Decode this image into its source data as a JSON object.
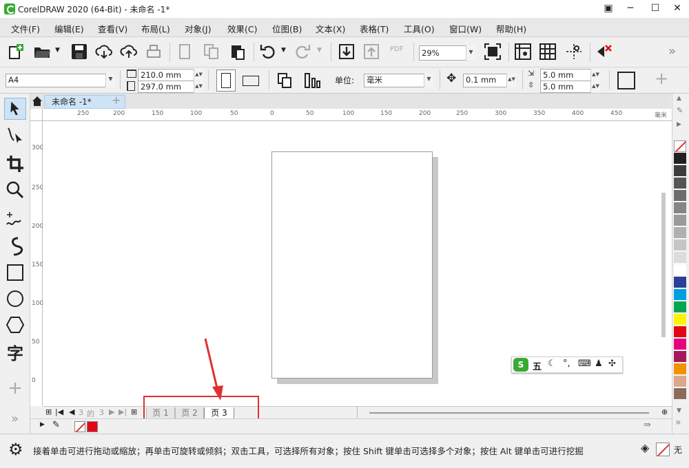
{
  "window": {
    "title": "CorelDRAW 2020 (64-Bit) - 未命名 -1*"
  },
  "menu": [
    "文件(F)",
    "编辑(E)",
    "查看(V)",
    "布局(L)",
    "对象(J)",
    "效果(C)",
    "位图(B)",
    "文本(X)",
    "表格(T)",
    "工具(O)",
    "窗口(W)",
    "帮助(H)"
  ],
  "toolbar": {
    "zoom": "29%",
    "pdf_label": "PDF"
  },
  "propbar": {
    "page_size": "A4",
    "width": "210.0 mm",
    "height": "297.0 mm",
    "unit_label": "单位:",
    "unit": "毫米",
    "nudge": "0.1 mm",
    "dup_x": "5.0 mm",
    "dup_y": "5.0 mm"
  },
  "doc_tab": {
    "name": "未命名 -1*"
  },
  "ruler_h": [
    "250",
    "200",
    "150",
    "100",
    "50",
    "0",
    "50",
    "100",
    "150",
    "200",
    "250",
    "300",
    "350",
    "400",
    "450",
    "毫米"
  ],
  "ruler_v": [
    "300",
    "250",
    "200",
    "150",
    "100",
    "50",
    "0"
  ],
  "ime": {
    "label": "五"
  },
  "pagebar": {
    "counter_current": "3",
    "counter_of": "的",
    "counter_total": "3",
    "tabs": [
      "页 1",
      "页 2",
      "页 3"
    ]
  },
  "status": {
    "hint": "接着单击可进行拖动或缩放；再单击可旋转或倾斜；双击工具，可选择所有对象；按住 Shift 键单击可选择多个对象；按住 Alt 键单击可进行挖掘",
    "fill_none": "无"
  },
  "tools_text": "字",
  "colors": {
    "accent": "#3aaa35",
    "highlight": "#e03030",
    "tab": "#cfe3f7"
  },
  "palette": [
    "#231f20",
    "#3d3d3d",
    "#555555",
    "#6d6d6d",
    "#858585",
    "#9a9a9a",
    "#b0b0b0",
    "#c6c6c6",
    "#dcdcdc",
    "#ffffff",
    "#2d3f97",
    "#009fe3",
    "#00a650",
    "#fff200",
    "#e30613",
    "#e6007e",
    "#a3195b",
    "#f39200",
    "#d9a98a",
    "#8c6b5d"
  ]
}
